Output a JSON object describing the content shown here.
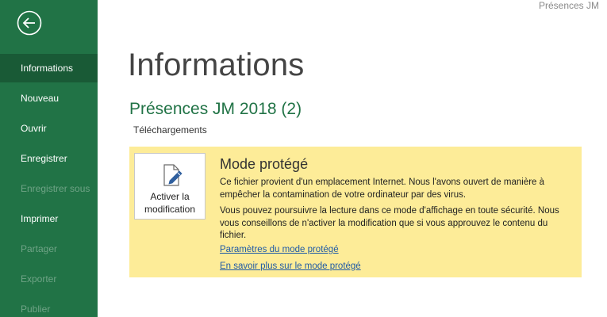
{
  "window": {
    "title": "Présences JM"
  },
  "sidebar": {
    "back_icon": "back-arrow-icon",
    "items": [
      {
        "label": "Informations",
        "state": "active"
      },
      {
        "label": "Nouveau",
        "state": "enabled"
      },
      {
        "label": "Ouvrir",
        "state": "enabled"
      },
      {
        "label": "Enregistrer",
        "state": "enabled"
      },
      {
        "label": "Enregistrer sous",
        "state": "disabled"
      },
      {
        "label": "Imprimer",
        "state": "enabled"
      },
      {
        "label": "Partager",
        "state": "disabled"
      },
      {
        "label": "Exporter",
        "state": "disabled"
      },
      {
        "label": "Publier",
        "state": "disabled"
      }
    ]
  },
  "main": {
    "page_title": "Informations",
    "document_name": "Présences JM 2018 (2)",
    "document_location": "Téléchargements"
  },
  "protected_view": {
    "enable_button_line1": "Activer la",
    "enable_button_line2": "modification",
    "enable_button_icon": "edit-document-icon",
    "heading": "Mode protégé",
    "paragraph1": "Ce fichier provient d'un emplacement Internet. Nous l'avons ouvert de manière à empêcher la contamination de votre ordinateur par des virus.",
    "paragraph2": "Vous pouvez poursuivre la lecture dans ce mode d'affichage en toute sécurité. Nous vous conseillons de n'activer la modification que si vous approuvez le contenu du fichier.",
    "link_settings": "Paramètres du mode protégé",
    "link_learn_more": "En savoir plus sur le mode protégé"
  },
  "colors": {
    "sidebar": "#217346",
    "sidebar_active": "#195a36",
    "banner": "#fdec98",
    "link": "#1f5aa6"
  }
}
